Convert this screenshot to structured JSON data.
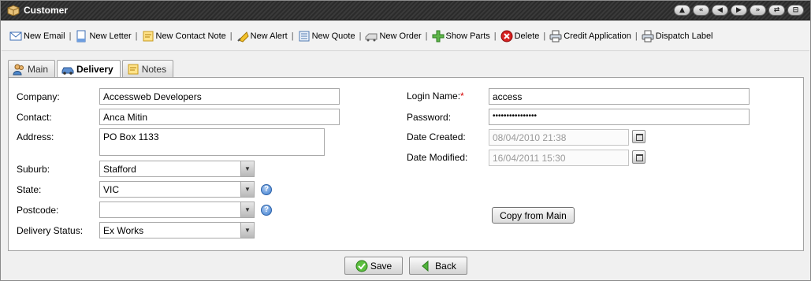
{
  "window": {
    "title": "Customer"
  },
  "title_buttons": [
    "▲",
    "«",
    "◀",
    "▶",
    "»",
    "⇄",
    "⊟"
  ],
  "toolbar": {
    "items": [
      {
        "label": "New Email",
        "icon": "email-icon"
      },
      {
        "label": "New Letter",
        "icon": "letter-icon"
      },
      {
        "label": "New Contact Note",
        "icon": "note-icon"
      },
      {
        "label": "New Alert",
        "icon": "alert-icon"
      },
      {
        "label": "New Quote",
        "icon": "quote-icon"
      },
      {
        "label": "New Order",
        "icon": "order-icon"
      },
      {
        "label": "Show Parts",
        "icon": "parts-icon"
      },
      {
        "label": "Delete",
        "icon": "delete-icon"
      },
      {
        "label": "Credit Application",
        "icon": "printer-icon"
      },
      {
        "label": "Dispatch Label",
        "icon": "printer-icon"
      }
    ],
    "separator": "|"
  },
  "tabs": [
    {
      "label": "Main",
      "active": false
    },
    {
      "label": "Delivery",
      "active": true
    },
    {
      "label": "Notes",
      "active": false
    }
  ],
  "form": {
    "company": {
      "label": "Company:",
      "value": "Accessweb Developers"
    },
    "contact": {
      "label": "Contact:",
      "value": "Anca Mitin"
    },
    "address": {
      "label": "Address:",
      "value": "PO Box 1133"
    },
    "suburb": {
      "label": "Suburb:",
      "value": "Stafford"
    },
    "state": {
      "label": "State:",
      "value": "VIC"
    },
    "postcode": {
      "label": "Postcode:",
      "value": ""
    },
    "delivery_status": {
      "label": "Delivery Status:",
      "value": "Ex Works"
    },
    "login_name": {
      "label": "Login Name:",
      "required": "*",
      "value": "access"
    },
    "password": {
      "label": "Password:",
      "value": "••••••••••••••••"
    },
    "date_created": {
      "label": "Date Created:",
      "value": "08/04/2010 21:38"
    },
    "date_modified": {
      "label": "Date Modified:",
      "value": "16/04/2011 15:30"
    },
    "copy_button": "Copy from Main",
    "help_glyph": "?"
  },
  "footer": {
    "save_label": "Save",
    "back_label": "Back"
  }
}
